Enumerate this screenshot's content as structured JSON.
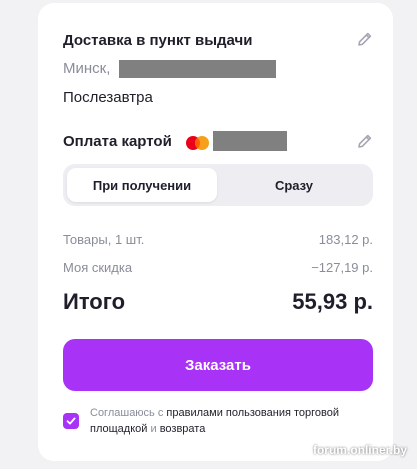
{
  "delivery": {
    "title": "Доставка в пункт выдачи",
    "city": "Минск,",
    "date": "Послезавтра"
  },
  "payment": {
    "title": "Оплата картой",
    "card_icon": "mastercard-icon",
    "options": [
      "При получении",
      "Сразу"
    ],
    "selected": "При получении"
  },
  "summary": {
    "goods_label": "Товары, 1 шт.",
    "goods_value": "183,12 р.",
    "discount_label": "Моя скидка",
    "discount_value": "−127,19 р.",
    "total_label": "Итого",
    "total_value": "55,93 р."
  },
  "order_button": "Заказать",
  "agreement": {
    "checked": true,
    "prefix": "Соглашаюсь с",
    "rules_link": "правилами пользования торговой площадкой",
    "and": "и",
    "return_link": "возврата"
  },
  "watermark": "forum.onliner.by",
  "colors": {
    "accent": "#a832f5",
    "text": "#1f1f2b",
    "muted": "#8a8d99"
  }
}
